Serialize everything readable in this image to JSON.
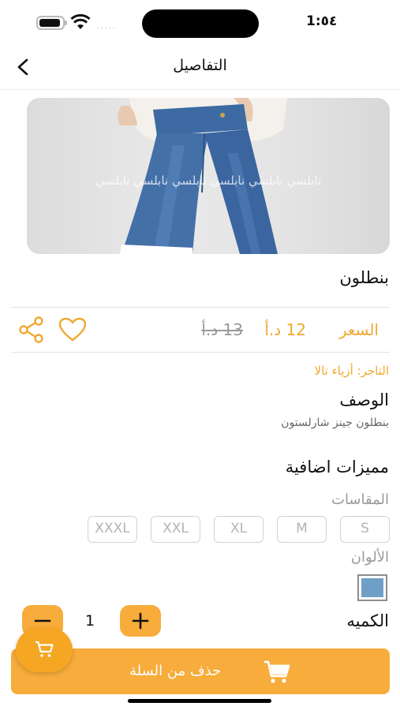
{
  "status_bar": {
    "time": "1:٥٤",
    "signal_dots": "....."
  },
  "header": {
    "title": "التفاصيل"
  },
  "product": {
    "image_watermark": "نابلسي نابلسي نابلسي نابلسي نابلسي نابلسي",
    "name": "بنطلون",
    "price_label": "السعر",
    "price_new": "12 د.أ",
    "price_old": "13 د.أ",
    "merchant": "التاجر: أزياء تالا",
    "description_title": "الوصف",
    "description": "بنطلون جينز شارلستون",
    "extras_title": "مميزات اضافية",
    "sizes_title": "المقاسات",
    "sizes": [
      "S",
      "M",
      "XL",
      "XXL",
      "XXXL"
    ],
    "colors_title": "الألوان",
    "colors": [
      "#6f9fc6"
    ],
    "quantity_label": "الكميه",
    "quantity": "1"
  },
  "cart_button": {
    "label": "حذف من السلة"
  },
  "theme": {
    "accent": "#f7ac3b",
    "accent_dark": "#f5a623"
  }
}
